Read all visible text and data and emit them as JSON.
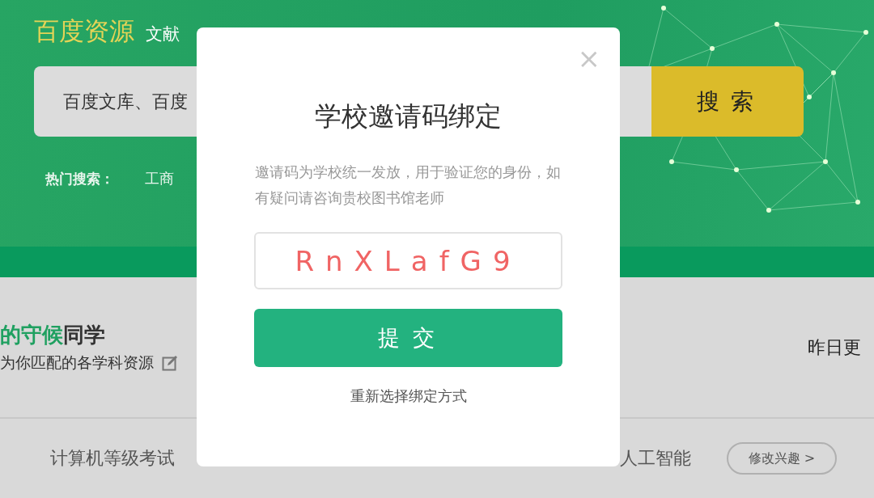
{
  "header": {
    "logo": "百度资源",
    "subtitle": "文献",
    "search": {
      "value": "百度文库、百度",
      "button": "搜索"
    },
    "hot_search": {
      "label": "热门搜索：",
      "items": [
        "工商"
      ]
    }
  },
  "greeting": {
    "title_highlight": "的守候",
    "title": "同学",
    "subtitle": "为你匹配的各学科资源",
    "update": "昨日更"
  },
  "interests": {
    "tabs": [
      "计算机等级考试",
      "人工智能"
    ],
    "edit_button": "修改兴趣 >"
  },
  "modal": {
    "close": "×",
    "title": "学校邀请码绑定",
    "description": "邀请码为学校统一发放，用于验证您的身份，如有疑问请咨询贵校图书馆老师",
    "code": {
      "value": "RnXLafG9"
    },
    "submit": "提交",
    "rebind_link": "重新选择绑定方式"
  }
}
